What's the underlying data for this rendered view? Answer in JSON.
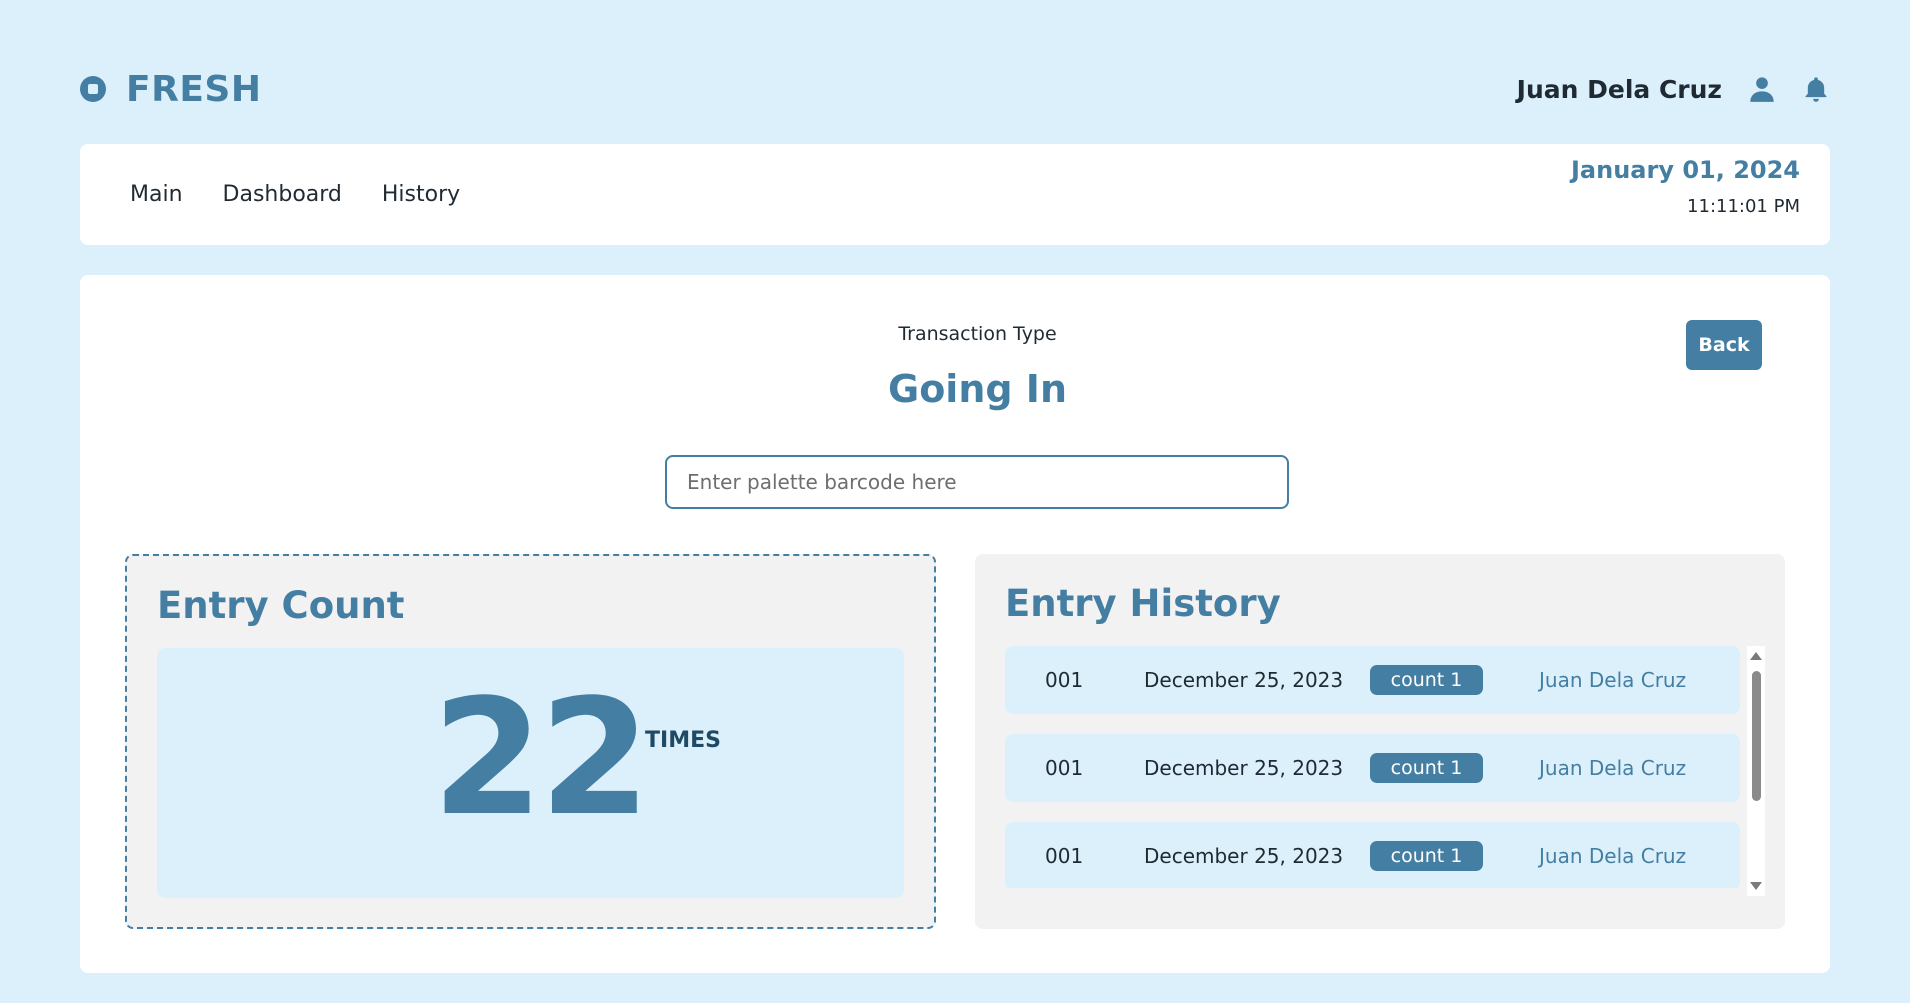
{
  "app": {
    "brand": "FRESH",
    "user_name": "Juan Dela Cruz",
    "accent_color": "#447fa3",
    "background_color": "#dcf0fb"
  },
  "nav": {
    "items": [
      "Main",
      "Dashboard",
      "History"
    ],
    "date": "January 01, 2024",
    "time": "11:11:01 PM"
  },
  "transaction": {
    "label": "Transaction Type",
    "value": "Going In",
    "back_label": "Back",
    "barcode_placeholder": "Enter palette barcode here",
    "barcode_value": ""
  },
  "entry_count": {
    "title": "Entry Count",
    "count": "22",
    "unit": "TIMES"
  },
  "entry_history": {
    "title": "Entry History",
    "rows": [
      {
        "id": "001",
        "date": "December 25, 2023",
        "badge": "count 1",
        "user": "Juan Dela Cruz"
      },
      {
        "id": "001",
        "date": "December 25, 2023",
        "badge": "count 1",
        "user": "Juan Dela Cruz"
      },
      {
        "id": "001",
        "date": "December 25, 2023",
        "badge": "count 1",
        "user": "Juan Dela Cruz"
      }
    ]
  },
  "icons": {
    "brand": "circle-stop-icon",
    "user": "user-icon",
    "notifications": "bell-icon"
  }
}
